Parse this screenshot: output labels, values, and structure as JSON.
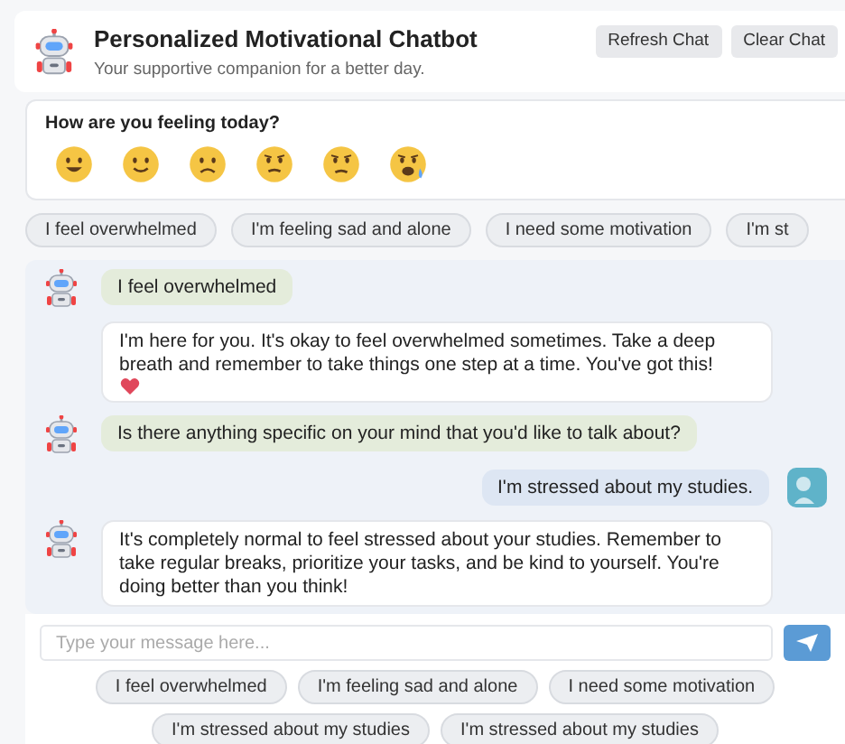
{
  "header": {
    "title": "Personalized Motivational Chatbot",
    "subtitle": "Your supportive companion for a better day.",
    "buttons": [
      "Refresh Chat",
      "Clear Chat"
    ]
  },
  "mood": {
    "question": "How are you feeling today?",
    "faces": [
      {
        "kind": "grin"
      },
      {
        "kind": "smile"
      },
      {
        "kind": "frown"
      },
      {
        "kind": "worried"
      },
      {
        "kind": "sad"
      },
      {
        "kind": "crying"
      }
    ]
  },
  "top_suggestions": [
    "I feel overwhelmed",
    "I'm feeling sad and alone",
    "I need some motivation",
    "I'm st"
  ],
  "messages": [
    {
      "kind": "prompt",
      "avatar": true,
      "text": "I feel overwhelmed",
      "heart": false
    },
    {
      "kind": "reply",
      "avatar": false,
      "text": "I'm here for you. It's okay to feel overwhelmed sometimes. Take a deep breath and remember to take things one step at a time. You've got this!",
      "heart": true
    },
    {
      "kind": "prompt",
      "avatar": true,
      "text": "Is there anything specific on your mind that you'd like to talk about?",
      "heart": false
    },
    {
      "kind": "user",
      "avatar": true,
      "text": "I'm stressed about my studies.",
      "heart": false
    },
    {
      "kind": "reply",
      "avatar": true,
      "text": "It's completely normal to feel stressed about your studies. Remember to take regular breaks, prioritize your tasks, and be kind to yourself. You're doing better than you think!",
      "heart": false
    }
  ],
  "input": {
    "placeholder": "Type your message here..."
  },
  "bottom_suggestions": [
    "I feel overwhelmed",
    "I'm feeling sad and alone",
    "I need some motivation",
    "I'm stressed about my studies",
    "I'm stressed about my studies"
  ]
}
